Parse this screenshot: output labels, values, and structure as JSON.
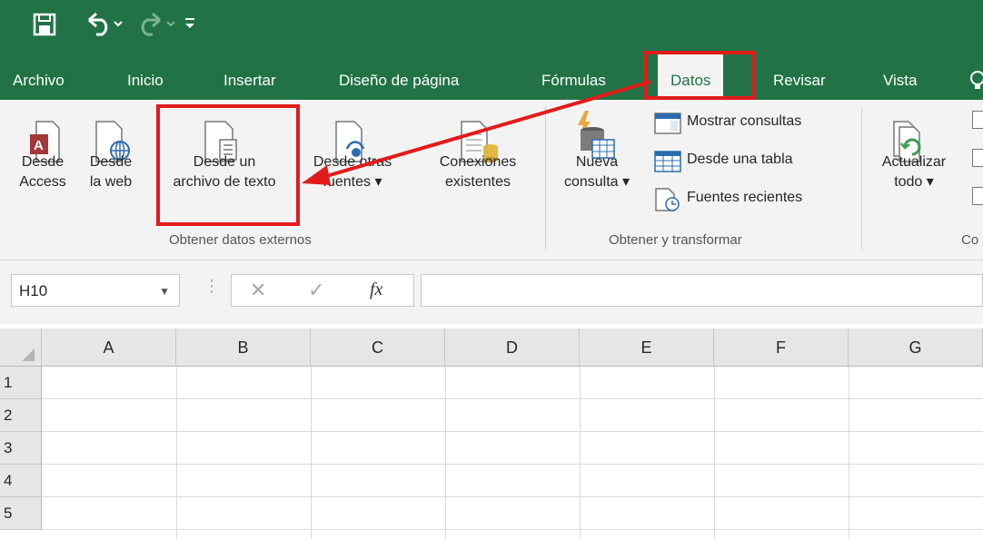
{
  "colors": {
    "brand": "#217346",
    "annotation": "#e31b1b",
    "ribbon_bg": "#f3f3f3"
  },
  "quick_access": {
    "save_icon": "save-icon",
    "undo_icon": "undo-icon",
    "redo_icon": "redo-icon",
    "customize_icon": "customize-qat-icon"
  },
  "tabs": [
    {
      "label": "Archivo"
    },
    {
      "label": "Inicio"
    },
    {
      "label": "Insertar"
    },
    {
      "label": "Diseño de página"
    },
    {
      "label": "Fórmulas"
    },
    {
      "label": "Datos",
      "active": true
    },
    {
      "label": "Revisar"
    },
    {
      "label": "Vista"
    }
  ],
  "ribbon": {
    "access": {
      "line1": "Desde",
      "line2": "Access"
    },
    "web": {
      "line1": "Desde",
      "line2": "la web"
    },
    "text": {
      "line1": "Desde un",
      "line2": "archivo de texto"
    },
    "other": {
      "line1": "Desde otras",
      "line2": "fuentes ▾"
    },
    "connections": {
      "line1": "Conexiones",
      "line2": "existentes"
    },
    "group1": "Obtener datos externos",
    "new_query": {
      "line1": "Nueva",
      "line2": "consulta ▾"
    },
    "show_queries": "Mostrar consultas",
    "from_table": "Desde una tabla",
    "recent_sources": "Fuentes recientes",
    "group2": "Obtener y transformar",
    "refresh": {
      "line1": "Actualizar",
      "line2": "todo ▾"
    },
    "group3": "Co"
  },
  "formula_bar": {
    "name_box": "H10",
    "cancel": "✕",
    "enter": "✓",
    "fx": "fx",
    "value": ""
  },
  "grid": {
    "columns": [
      "A",
      "B",
      "C",
      "D",
      "E",
      "F",
      "G"
    ],
    "rows": [
      "1",
      "2",
      "3",
      "4",
      "5"
    ]
  }
}
